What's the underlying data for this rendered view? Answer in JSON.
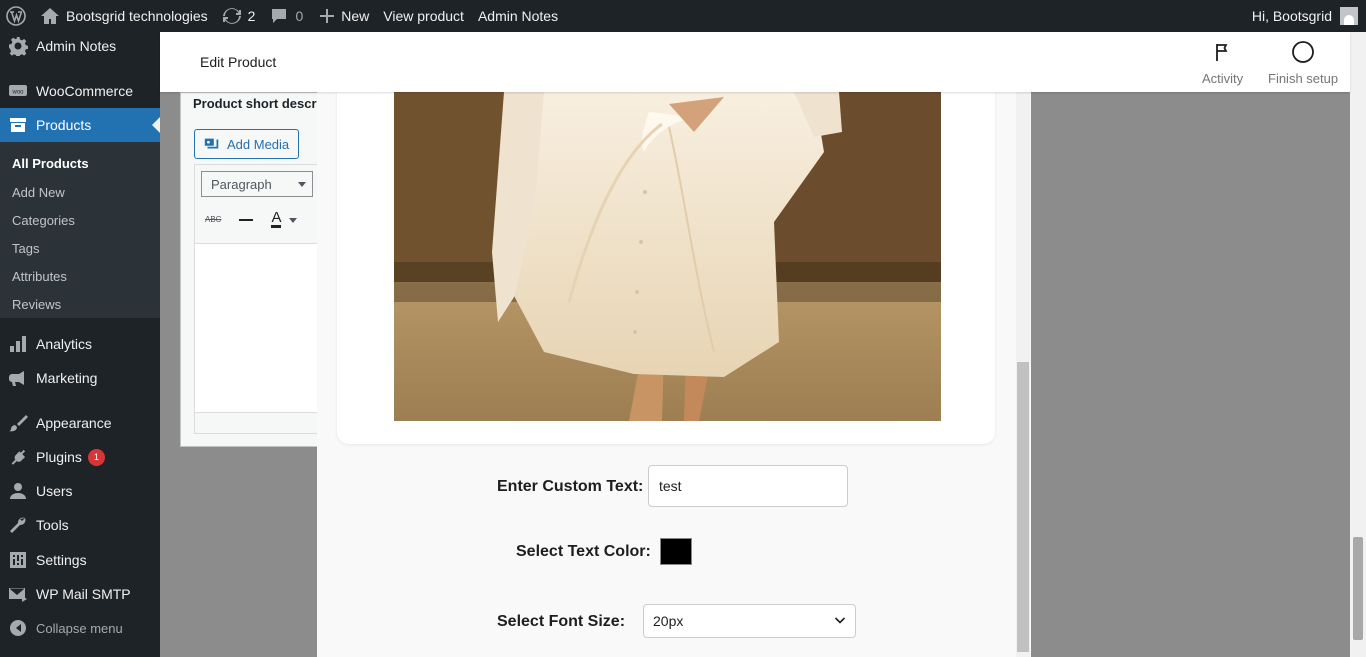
{
  "adminbar": {
    "site_name": "Bootsgrid technologies",
    "updates_count": "2",
    "comments_count": "0",
    "new_label": "New",
    "view_product": "View product",
    "admin_notes": "Admin Notes",
    "greeting": "Hi, Bootsgrid"
  },
  "sidebar": {
    "items": [
      {
        "label": "Admin Notes",
        "icon": "gear-icon"
      },
      {
        "label": "WooCommerce",
        "icon": "woo-icon"
      },
      {
        "label": "Products",
        "icon": "archive-icon"
      },
      {
        "label": "Analytics",
        "icon": "bar-chart-icon"
      },
      {
        "label": "Marketing",
        "icon": "megaphone-icon"
      },
      {
        "label": "Appearance",
        "icon": "brush-icon"
      },
      {
        "label": "Plugins",
        "icon": "plug-icon",
        "badge": "1"
      },
      {
        "label": "Users",
        "icon": "user-icon"
      },
      {
        "label": "Tools",
        "icon": "wrench-icon"
      },
      {
        "label": "Settings",
        "icon": "settings-icon"
      },
      {
        "label": "WP Mail SMTP",
        "icon": "mail-icon"
      }
    ],
    "submenu": [
      "All Products",
      "Add New",
      "Categories",
      "Tags",
      "Attributes",
      "Reviews"
    ],
    "collapse": "Collapse menu"
  },
  "header": {
    "title": "Edit Product",
    "activity": "Activity",
    "finish_setup": "Finish setup"
  },
  "editor": {
    "short_desc_label": "Product short descr",
    "add_media": "Add Media",
    "format_select": "Paragraph",
    "strike_label": "ABC",
    "color_letter": "A"
  },
  "customizer": {
    "custom_text_label": "Enter Custom Text:",
    "custom_text_value": "test",
    "text_color_label": "Select Text Color:",
    "text_color_value": "#000000",
    "font_size_label": "Select Font Size:",
    "font_size_value": "20px"
  },
  "colors": {
    "accent": "#2271b1",
    "adminbar_bg": "#1d2327",
    "badge": "#d63638"
  }
}
